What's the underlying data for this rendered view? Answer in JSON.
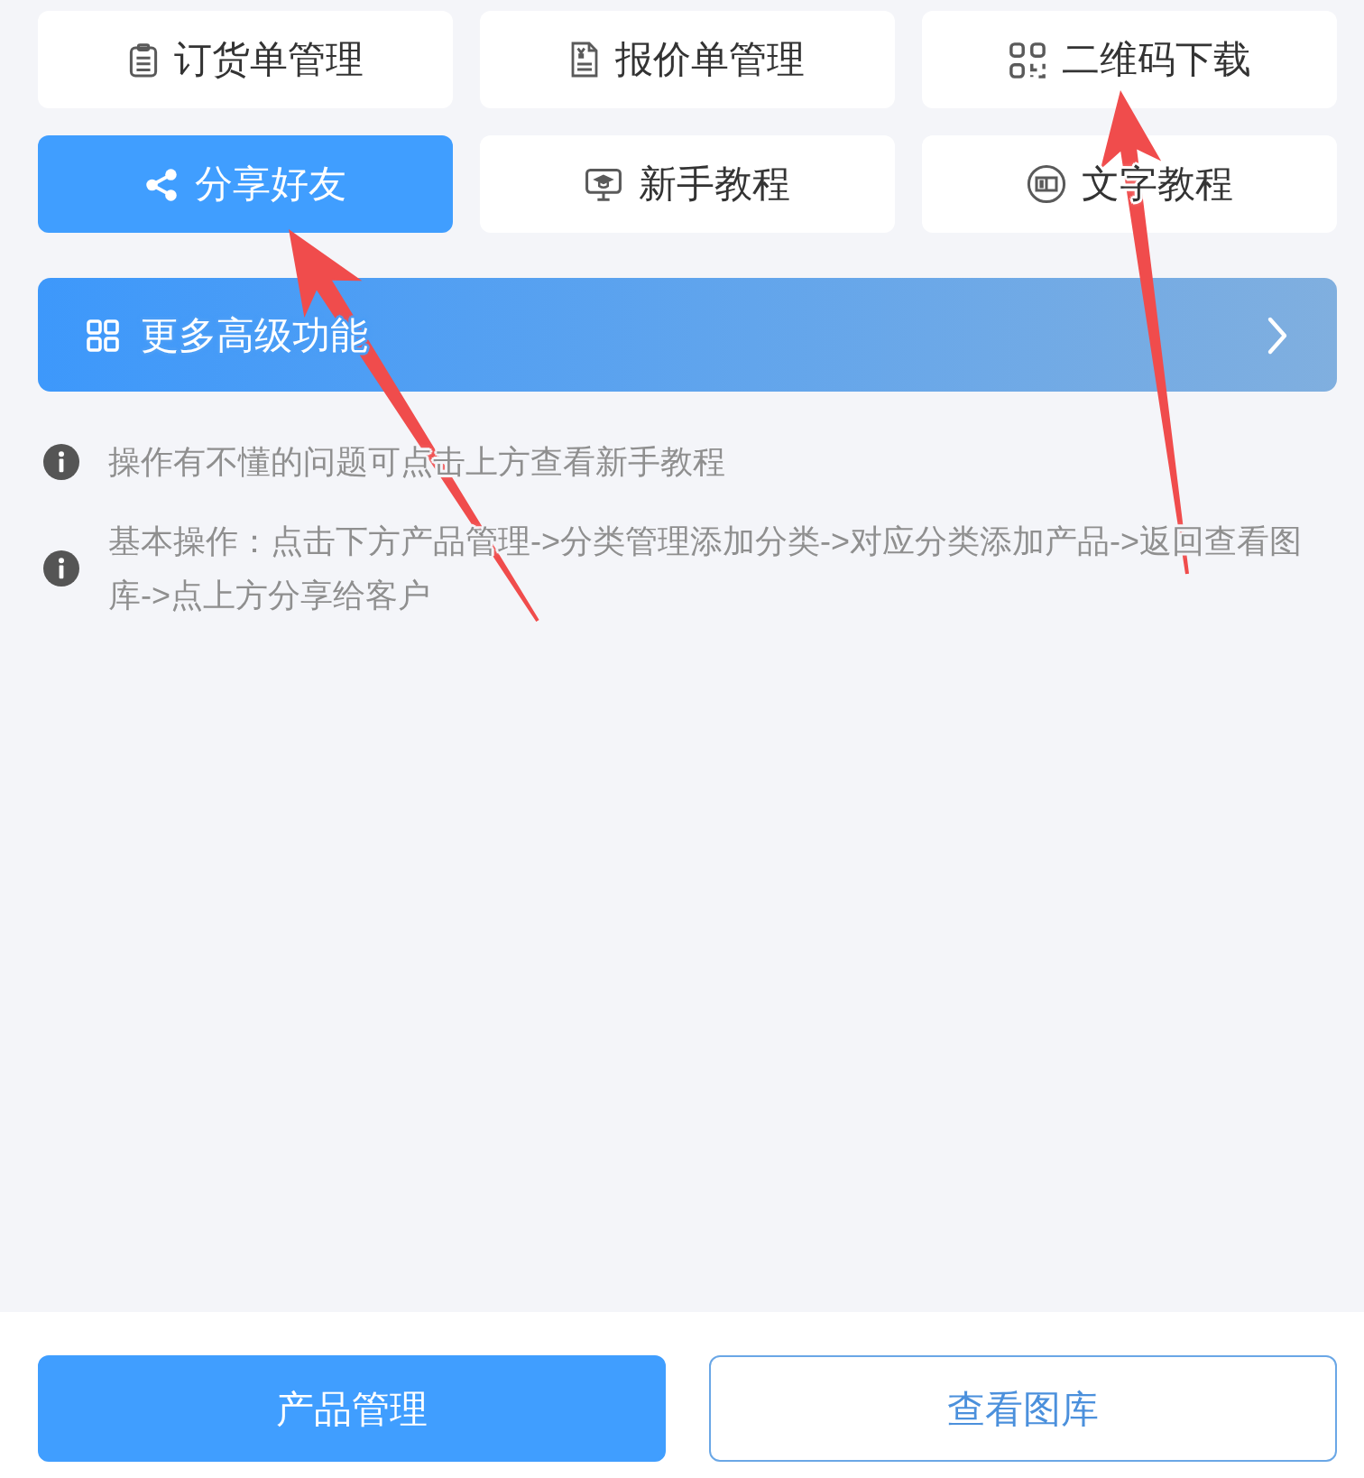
{
  "tiles": [
    {
      "label": "订货单管理",
      "kind": "plain"
    },
    {
      "label": "报价单管理",
      "kind": "plain"
    },
    {
      "label": "二维码下载",
      "kind": "plain"
    },
    {
      "label": "分享好友",
      "kind": "primary"
    },
    {
      "label": "新手教程",
      "kind": "plain"
    },
    {
      "label": "文字教程",
      "kind": "plain"
    }
  ],
  "banner": {
    "label": "更多高级功能"
  },
  "tips": [
    {
      "text": "操作有不懂的问题可点击上方查看新手教程"
    },
    {
      "text": "基本操作：点击下方产品管理->分类管理添加分类->对应分类添加产品->返回查看图库->点上方分享给客户"
    }
  ],
  "bottom_buttons": [
    {
      "label": "产品管理",
      "kind": "primary"
    },
    {
      "label": "查看图库",
      "kind": "outline"
    }
  ]
}
